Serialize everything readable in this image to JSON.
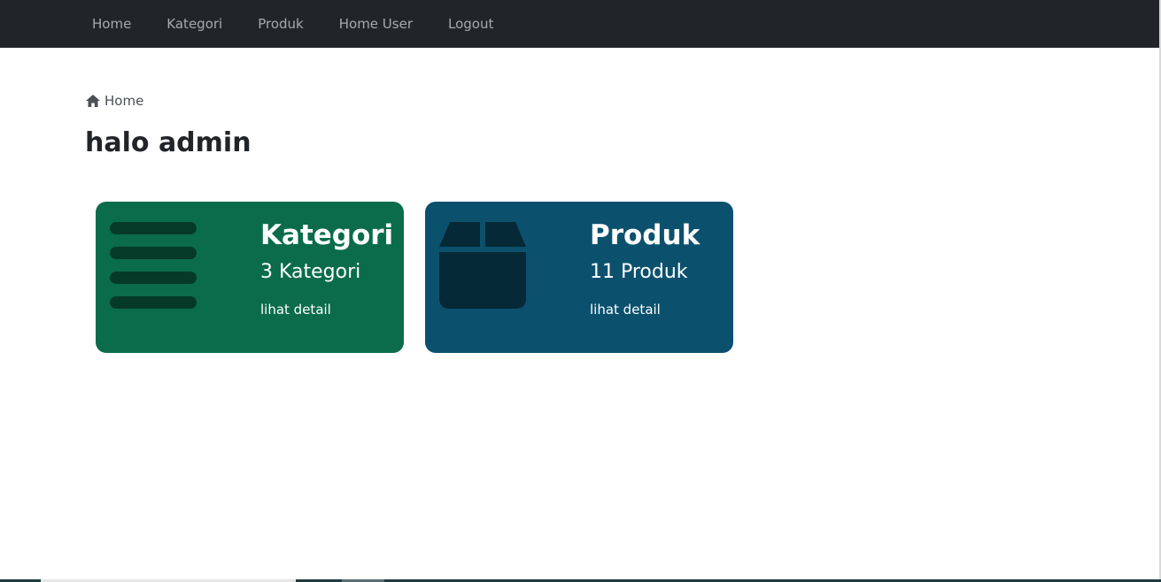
{
  "navbar": {
    "links": [
      "Home",
      "Kategori",
      "Produk",
      "Home User",
      "Logout"
    ],
    "background": "#212529"
  },
  "breadcrumb": {
    "icon": "home-icon",
    "label": "Home"
  },
  "page": {
    "title": "halo admin"
  },
  "cards": [
    {
      "icon": "list-icon",
      "title": "Kategori",
      "count": "3 Kategori",
      "link": "lihat detail",
      "color": "#0a6c4a"
    },
    {
      "icon": "box-icon",
      "title": "Produk",
      "count": "11 Produk",
      "link": "lihat detail",
      "color": "#0b516e"
    }
  ]
}
